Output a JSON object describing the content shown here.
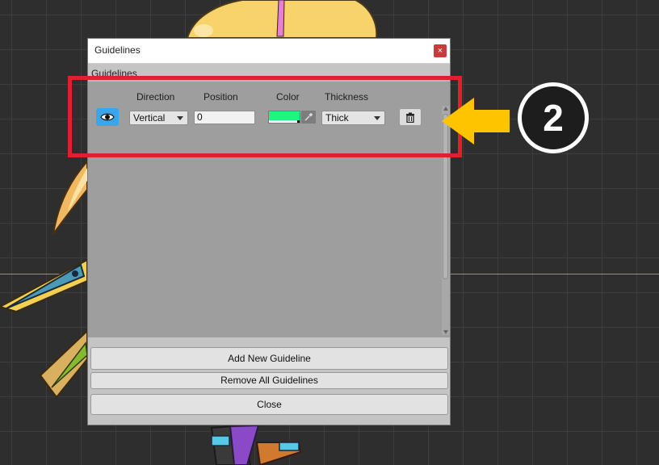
{
  "dialog": {
    "title": "Guidelines",
    "close_glyph": "×",
    "section_label": "Guidelines"
  },
  "columns": {
    "direction": "Direction",
    "position": "Position",
    "color": "Color",
    "thickness": "Thickness"
  },
  "guideline_row": {
    "visible_icon": "eye-icon",
    "direction_value": "Vertical",
    "position_value": "0",
    "color_hex": "#1cf77f",
    "thickness_value": "Thick",
    "delete_icon": "trash-icon"
  },
  "buttons": {
    "add": "Add New Guideline",
    "remove_all": "Remove All Guidelines",
    "close": "Close"
  },
  "annotation": {
    "step_number": "2",
    "highlight_color": "#e21f2a",
    "arrow_color": "#fec400"
  },
  "colors": {
    "canvas_background": "#2e2e2e",
    "eye_button": "#3aa5e8"
  }
}
